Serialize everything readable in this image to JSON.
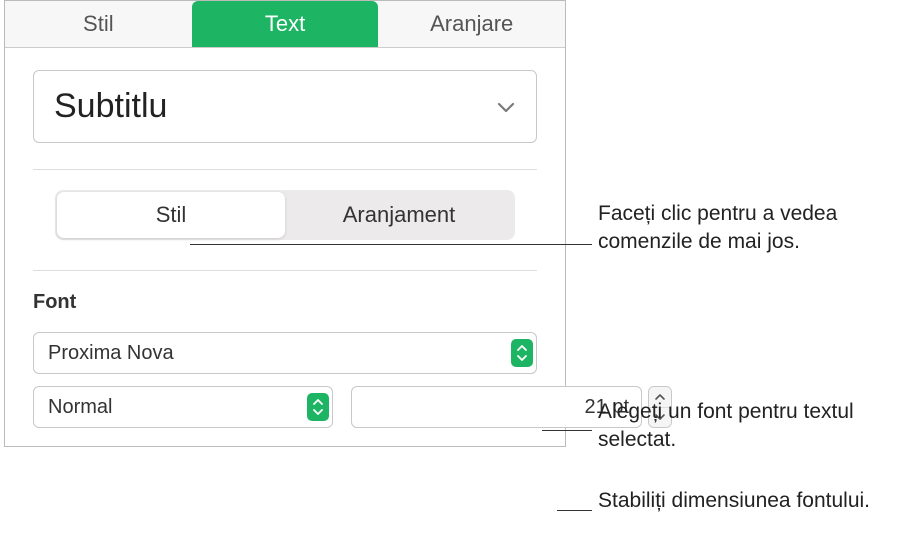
{
  "tabs": {
    "stil": "Stil",
    "text": "Text",
    "aranjare": "Aranjare"
  },
  "style_dropdown": {
    "value": "Subtitlu"
  },
  "segmented": {
    "stil": "Stil",
    "aranjament": "Aranjament"
  },
  "font": {
    "section_label": "Font",
    "family": "Proxima Nova",
    "weight": "Normal",
    "size": "21 pt"
  },
  "callouts": {
    "c1": "Faceți clic pentru a vedea comenzile de mai jos.",
    "c2": "Alegeți un font pentru textul selectat.",
    "c3": "Stabiliți dimensiunea fontului."
  }
}
